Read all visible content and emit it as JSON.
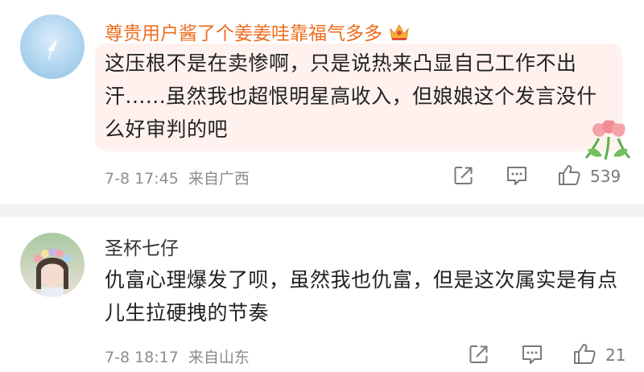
{
  "comments": [
    {
      "username": "尊贵用户酱了个姜姜哇靠福气多多",
      "text": "这压根不是在卖惨啊，只是说热来凸显自己工作不出汗......虽然我也超恨明星高收入，但娘娘这个发言没什么好审判的吧",
      "time": "7-8 17:45",
      "location": "来自广西",
      "like_count": "539",
      "badge_icon": "crown-icon",
      "accent_color": "#ec6d1f",
      "bubble_color": "#fff2ee"
    },
    {
      "username": "圣杯七仔",
      "text": "仇富心理爆发了呗，虽然我也仇富，但是这次属实是有点儿生拉硬拽的节奏",
      "time": "7-8 18:17",
      "location": "来自山东",
      "like_count": "21"
    }
  ],
  "icons": {
    "share": "share-icon",
    "reply": "comment-icon",
    "like": "thumbs-up-icon"
  }
}
